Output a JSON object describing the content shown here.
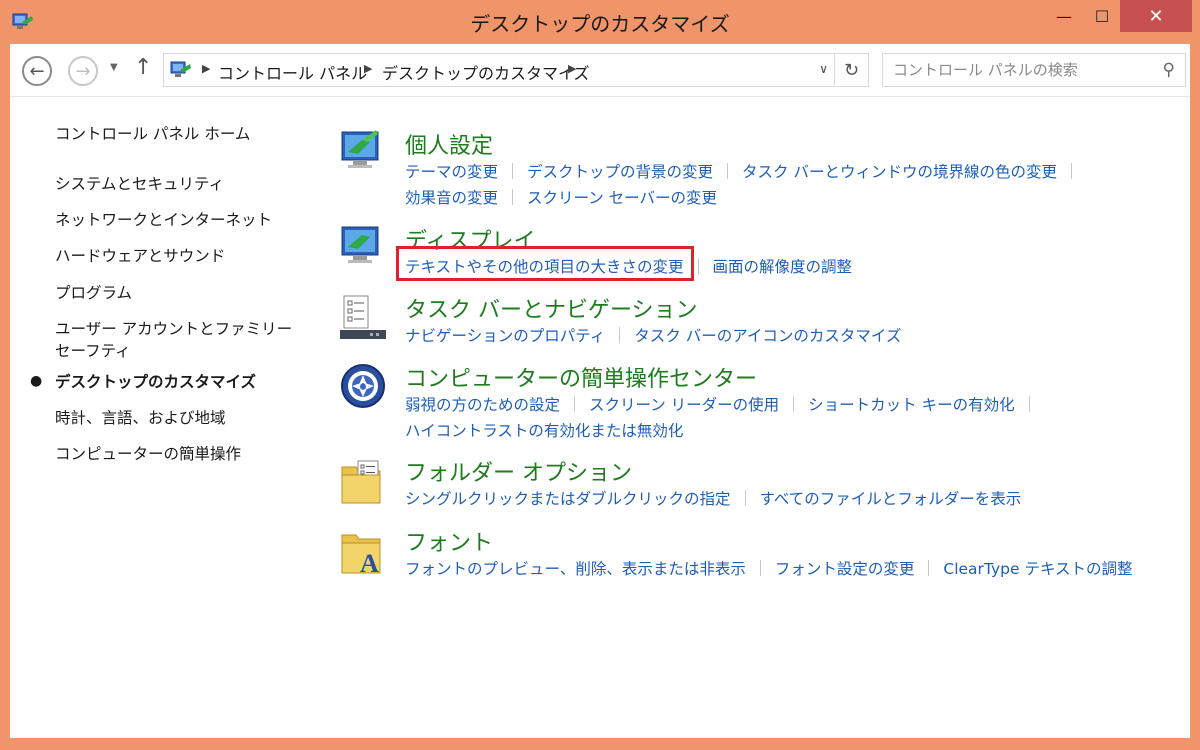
{
  "window": {
    "title": "デスクトップのカスタマイズ",
    "minimize": "—",
    "maximize": "☐",
    "close": "✕"
  },
  "nav": {
    "back_glyph": "←",
    "forward_glyph": "→",
    "recent_glyph": "▼",
    "up_glyph": "↑",
    "crumbs": [
      "コントロール パネル",
      "デスクトップのカスタマイズ"
    ],
    "crumb_sep": "▶",
    "drop_glyph": "∨",
    "refresh_glyph": "↻",
    "search_placeholder": "コントロール パネルの検索",
    "search_glyph": "⚲"
  },
  "sidebar": {
    "home": "コントロール パネル ホーム",
    "items": [
      "システムとセキュリティ",
      "ネットワークとインターネット",
      "ハードウェアとサウンド",
      "プログラム",
      "ユーザー アカウントとファミリー セーフティ",
      "デスクトップのカスタマイズ",
      "時計、言語、および地域",
      "コンピューターの簡単操作"
    ],
    "bullet": "●",
    "current_index": 5
  },
  "categories": [
    {
      "title": "個人設定",
      "icon": "personalization-icon",
      "rows": [
        [
          "テーマの変更",
          "デスクトップの背景の変更",
          "タスク バーとウィンドウの境界線の色の変更"
        ],
        [
          "効果音の変更",
          "スクリーン セーバーの変更"
        ]
      ]
    },
    {
      "title": "ディスプレイ",
      "icon": "display-icon",
      "rows": [
        [
          "テキストやその他の項目の大きさの変更",
          "画面の解像度の調整"
        ]
      ]
    },
    {
      "title": "タスク バーとナビゲーション",
      "icon": "taskbar-icon",
      "rows": [
        [
          "ナビゲーションのプロパティ",
          "タスク バーのアイコンのカスタマイズ"
        ]
      ]
    },
    {
      "title": "コンピューターの簡単操作センター",
      "icon": "ease-of-access-icon",
      "rows": [
        [
          "弱視の方のための設定",
          "スクリーン リーダーの使用",
          "ショートカット キーの有効化"
        ],
        [
          "ハイコントラストの有効化または無効化"
        ]
      ]
    },
    {
      "title": "フォルダー オプション",
      "icon": "folder-options-icon",
      "rows": [
        [
          "シングルクリックまたはダブルクリックの指定",
          "すべてのファイルとフォルダーを表示"
        ]
      ]
    },
    {
      "title": "フォント",
      "icon": "fonts-icon",
      "rows": [
        [
          "フォントのプレビュー、削除、表示または非表示",
          "フォント設定の変更",
          "ClearType テキストの調整"
        ]
      ]
    }
  ],
  "colors": {
    "frame": "#F0946A",
    "category_title": "#1E7B1E",
    "link": "#1E5EB8",
    "highlight": "#E0202A",
    "close_button": "#C75050"
  }
}
